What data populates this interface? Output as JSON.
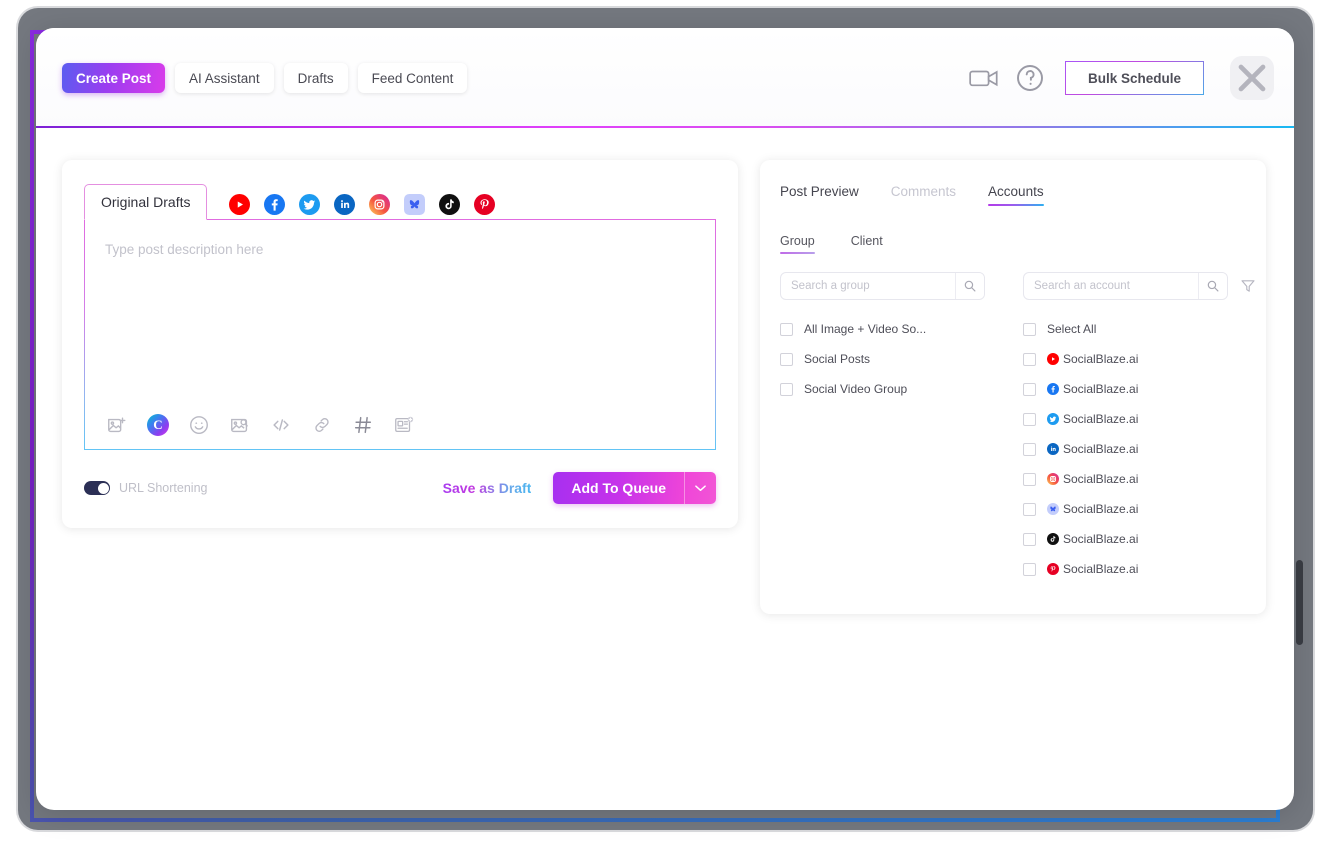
{
  "header": {
    "tabs": [
      {
        "label": "Create Post",
        "active": true
      },
      {
        "label": "AI Assistant",
        "active": false
      },
      {
        "label": "Drafts",
        "active": false
      },
      {
        "label": "Feed Content",
        "active": false
      }
    ],
    "video_icon": "video-camera-icon",
    "help_icon": "help-circle-icon",
    "bulk_schedule_label": "Bulk Schedule",
    "close_icon": "close-icon"
  },
  "editor": {
    "draft_tab_label": "Original Drafts",
    "platforms": [
      {
        "name": "youtube",
        "color": "#ff0000"
      },
      {
        "name": "facebook",
        "color": "#1877f2"
      },
      {
        "name": "twitter",
        "color": "#1d9bf0"
      },
      {
        "name": "linkedin",
        "color": "#0a66c2"
      },
      {
        "name": "instagram",
        "color": "#e1306c"
      },
      {
        "name": "bluesky",
        "color": "#7b8ef5"
      },
      {
        "name": "tiktok",
        "color": "#101010"
      },
      {
        "name": "pinterest",
        "color": "#e60023"
      }
    ],
    "placeholder": "Type post description here",
    "toolbar": [
      {
        "name": "add-image-icon"
      },
      {
        "name": "canva-icon"
      },
      {
        "name": "emoji-icon"
      },
      {
        "name": "image-search-icon"
      },
      {
        "name": "code-icon"
      },
      {
        "name": "link-icon"
      },
      {
        "name": "hashtag-icon"
      },
      {
        "name": "media-card-icon"
      }
    ],
    "url_shortening_label": "URL Shortening",
    "url_shortening_on": true,
    "save_draft_label": "Save as Draft",
    "add_to_queue_label": "Add To Queue",
    "queue_caret_icon": "chevron-down-icon"
  },
  "preview": {
    "tabs": [
      {
        "label": "Post Preview",
        "active": false,
        "muted": false
      },
      {
        "label": "Comments",
        "active": false,
        "muted": true
      },
      {
        "label": "Accounts",
        "active": true,
        "muted": false
      }
    ],
    "sub_tabs": [
      {
        "label": "Group",
        "active": true
      },
      {
        "label": "Client",
        "active": false
      }
    ],
    "group_search_placeholder": "Search a group",
    "group_search_value": "",
    "account_search_placeholder": "Search an account",
    "account_search_value": "",
    "search_icon": "search-icon",
    "filter_icon": "filter-funnel-icon",
    "groups": [
      {
        "label": "All Image + Video So...",
        "checked": false
      },
      {
        "label": "Social Posts",
        "checked": false
      },
      {
        "label": "Social Video Group",
        "checked": false
      }
    ],
    "select_all_label": "Select All",
    "accounts": [
      {
        "label": "SocialBlaze.ai",
        "platform": "youtube",
        "color": "#ff0000",
        "checked": false
      },
      {
        "label": "SocialBlaze.ai",
        "platform": "facebook",
        "color": "#1877f2",
        "checked": false
      },
      {
        "label": "SocialBlaze.ai",
        "platform": "twitter",
        "color": "#1d9bf0",
        "checked": false
      },
      {
        "label": "SocialBlaze.ai",
        "platform": "linkedin",
        "color": "#0a66c2",
        "checked": false
      },
      {
        "label": "SocialBlaze.ai",
        "platform": "instagram",
        "color": "#e1306c",
        "checked": false
      },
      {
        "label": "SocialBlaze.ai",
        "platform": "bluesky",
        "color": "#7b8ef5",
        "checked": false
      },
      {
        "label": "SocialBlaze.ai",
        "platform": "tiktok",
        "color": "#101010",
        "checked": false
      },
      {
        "label": "SocialBlaze.ai",
        "platform": "pinterest",
        "color": "#e60023",
        "checked": false
      }
    ]
  },
  "colors": {
    "accent_purple": "#a72ff0",
    "accent_pink": "#ef45d8",
    "accent_blue": "#17b9f3",
    "frame_gray": "#74787f"
  }
}
